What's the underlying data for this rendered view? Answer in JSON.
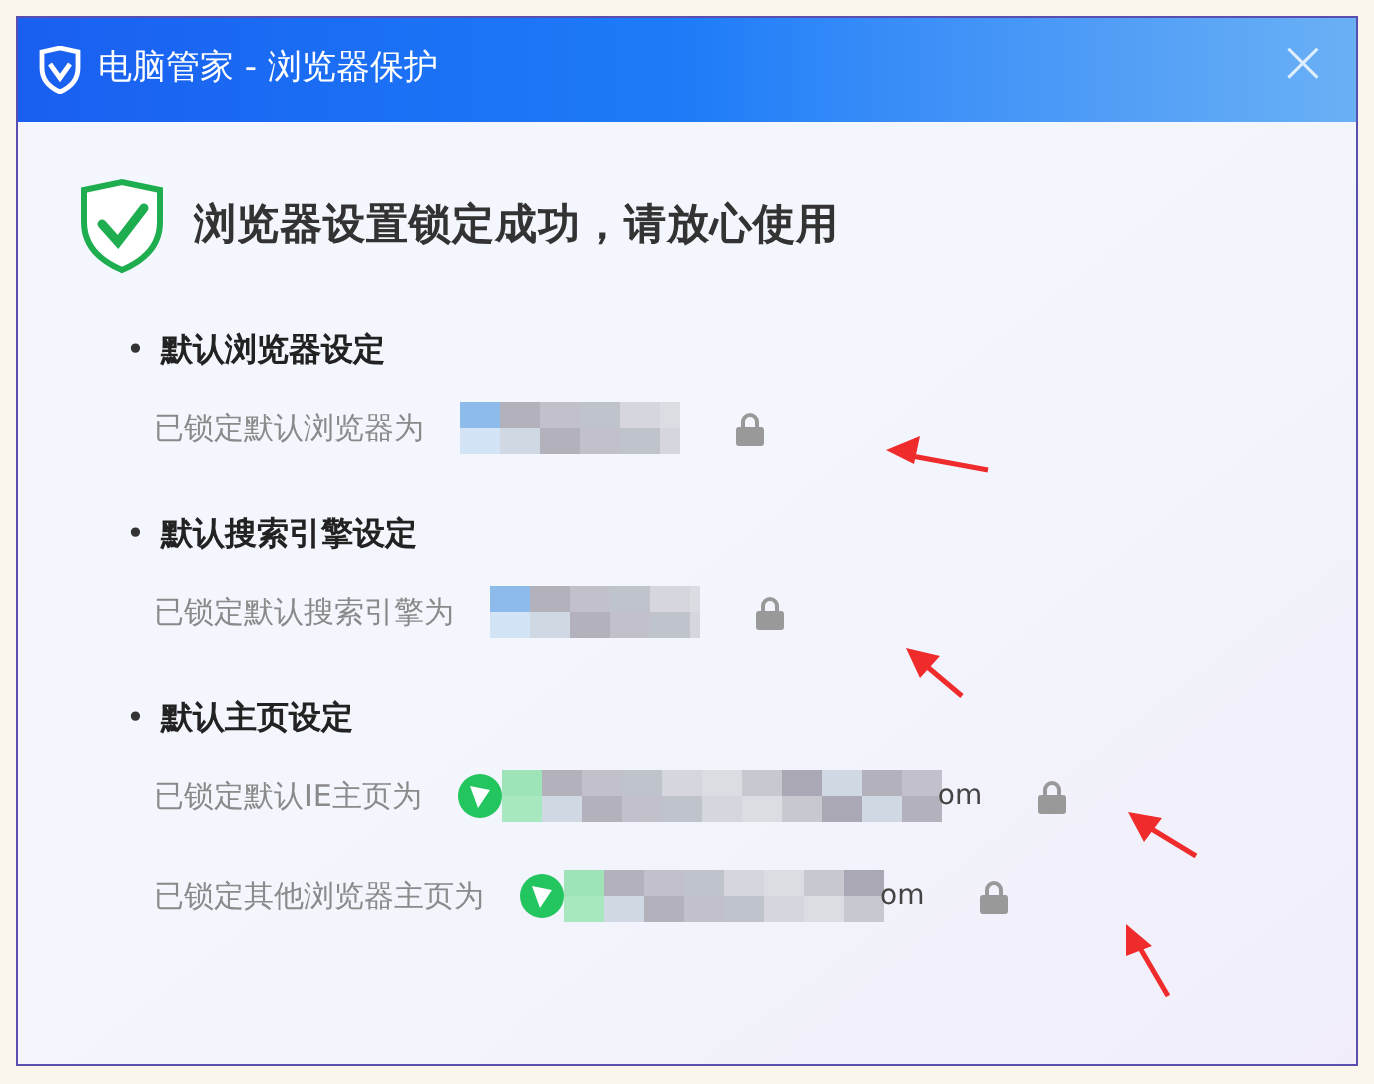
{
  "window": {
    "title": "电脑管家 - 浏览器保护",
    "close": "×"
  },
  "headline": "浏览器设置锁定成功，请放心使用",
  "sections": [
    {
      "bullet": "•",
      "heading": "默认浏览器设定",
      "rows": [
        {
          "label": "已锁定默认浏览器为",
          "site_icon": false,
          "value_end": null,
          "locked": true
        }
      ]
    },
    {
      "bullet": "•",
      "heading": "默认搜索引擎设定",
      "rows": [
        {
          "label": "已锁定默认搜索引擎为",
          "site_icon": false,
          "value_end": null,
          "locked": true
        }
      ]
    },
    {
      "bullet": "•",
      "heading": "默认主页设定",
      "rows": [
        {
          "label": "已锁定默认IE主页为",
          "site_icon": true,
          "value_end": "om",
          "locked": true
        },
        {
          "label": "已锁定其他浏览器主页为",
          "site_icon": true,
          "value_end": "om",
          "locked": true
        }
      ]
    }
  ]
}
